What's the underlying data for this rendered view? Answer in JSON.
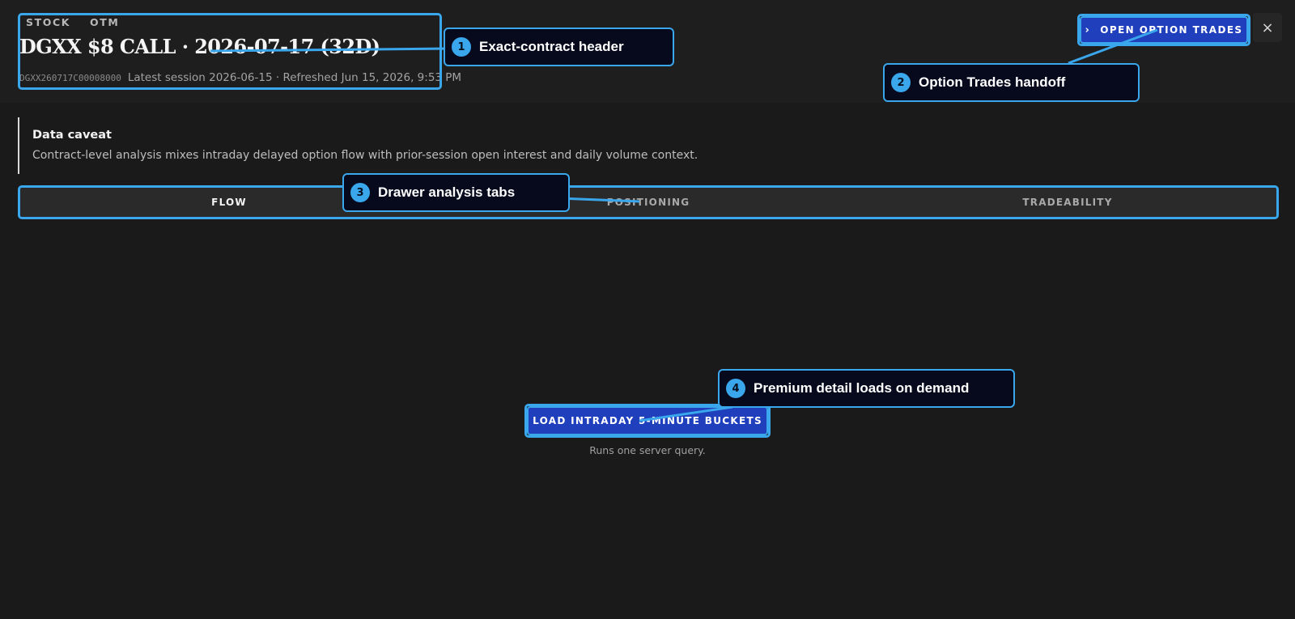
{
  "header": {
    "tags": [
      "STOCK",
      "OTM"
    ],
    "title": "DGXX $8 CALL · 2026-07-17 (32D)",
    "occ_symbol": "DGXX260717C00008000",
    "session_info": "Latest session 2026-06-15 · Refreshed Jun 15, 2026, 9:53 PM",
    "open_trades_label": "OPEN OPTION TRADES",
    "open_trades_icon": "chevron-right-icon",
    "close_icon": "close-icon",
    "close_glyph": "×"
  },
  "caveat": {
    "title": "Data caveat",
    "text": "Contract-level analysis mixes intraday delayed option flow with prior-session open interest and daily volume context."
  },
  "tabs": [
    {
      "label": "FLOW",
      "active": true
    },
    {
      "label": "POSITIONING",
      "active": false
    },
    {
      "label": "TRADEABILITY",
      "active": false
    }
  ],
  "load": {
    "button_label": "LOAD INTRADAY 5-MINUTE BUCKETS",
    "hint": "Runs one server query."
  },
  "callouts": [
    {
      "number": "1",
      "text": "Exact-contract header"
    },
    {
      "number": "2",
      "text": "Option Trades handoff"
    },
    {
      "number": "3",
      "text": "Drawer analysis tabs"
    },
    {
      "number": "4",
      "text": "Premium detail loads on demand"
    }
  ],
  "colors": {
    "background": "#1a1a1a",
    "primary_button": "#1f3fbd",
    "annotation_accent": "#3aa6ec"
  }
}
